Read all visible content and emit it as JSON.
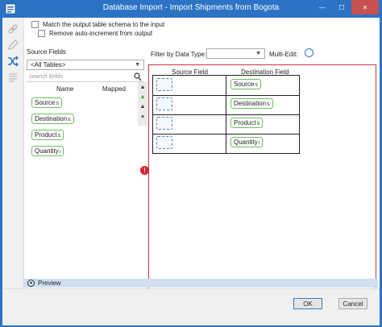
{
  "window": {
    "title": "Database Import - Import Shipments from Bogota",
    "minimize": "—",
    "maximize": "☐",
    "close": "✕"
  },
  "options": {
    "match_schema": "Match the output table schema to the input",
    "remove_autoinc": "Remove auto-increment from output"
  },
  "source": {
    "title": "Source Fields",
    "table_select": "<All Tables>",
    "search_placeholder": "search fields",
    "col_name": "Name",
    "col_mapped": "Mapped",
    "fields": [
      {
        "label": "Source",
        "sub": "S"
      },
      {
        "label": "Destination",
        "sub": "S"
      },
      {
        "label": "Product",
        "sub": "S"
      },
      {
        "label": "Quantity",
        "sub": "I"
      }
    ]
  },
  "mapping": {
    "filter_label": "Filter by Data Type:",
    "filter_value": "",
    "multi_edit_label": "Multi-Edit:",
    "col_source": "Source Field",
    "col_destination": "Destination Field",
    "rows": [
      {
        "destination": "Source",
        "sub": "S"
      },
      {
        "destination": "Destination",
        "sub": "S"
      },
      {
        "destination": "Product",
        "sub": "S"
      },
      {
        "destination": "Quantity",
        "sub": "I"
      }
    ]
  },
  "error_badge": "!",
  "preview": {
    "label": "Preview"
  },
  "buttons": {
    "ok": "OK",
    "cancel": "Cancel"
  },
  "colors": {
    "titlebar": "#2d73c5",
    "close": "#c75050",
    "pill_border": "#6cbf5f",
    "error": "#d9232e",
    "panel_border": "#cc3340"
  },
  "icons": [
    "database-import-icon",
    "link-icon",
    "pencil-icon",
    "shuffle-icon",
    "list-icon",
    "search-icon"
  ]
}
